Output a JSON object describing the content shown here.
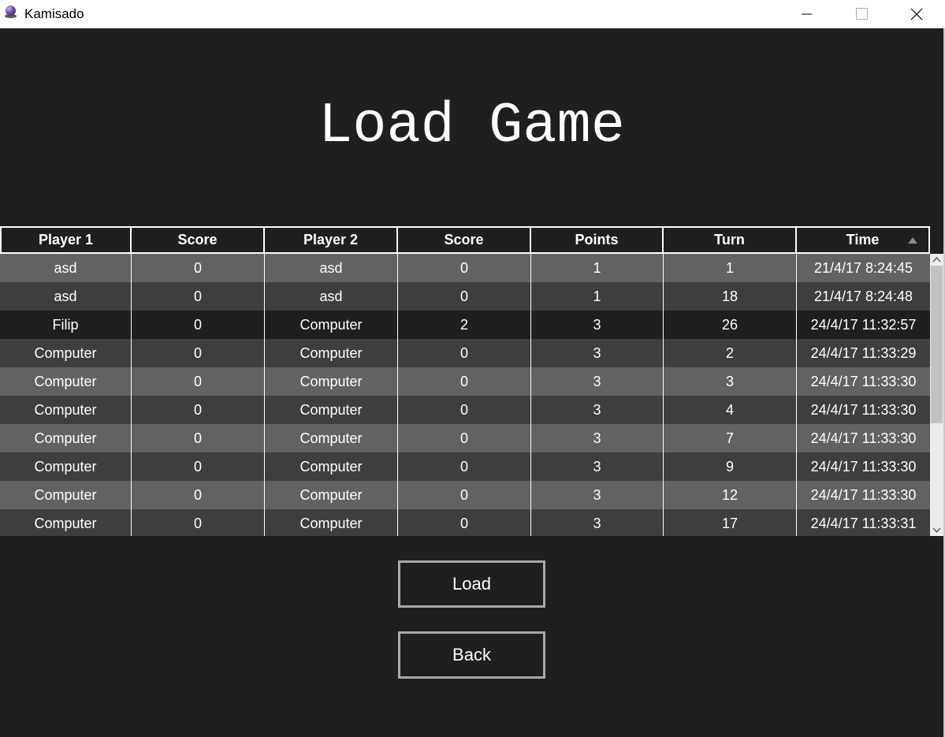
{
  "window": {
    "title": "Kamisado",
    "controls": [
      "minimize-icon",
      "maximize-icon",
      "close-icon"
    ]
  },
  "page": {
    "heading": "Load Game"
  },
  "table": {
    "columns": [
      "Player 1",
      "Score",
      "Player 2",
      "Score",
      "Points",
      "Turn",
      "Time"
    ],
    "sorted_column": "Time",
    "sort_direction": "ascending",
    "selected_row": 2,
    "rows": [
      [
        "asd",
        "0",
        "asd",
        "0",
        "1",
        "1",
        "21/4/17 8:24:45"
      ],
      [
        "asd",
        "0",
        "asd",
        "0",
        "1",
        "18",
        "21/4/17 8:24:48"
      ],
      [
        "Filip",
        "0",
        "Computer",
        "2",
        "3",
        "26",
        "24/4/17 11:32:57"
      ],
      [
        "Computer",
        "0",
        "Computer",
        "0",
        "3",
        "2",
        "24/4/17 11:33:29"
      ],
      [
        "Computer",
        "0",
        "Computer",
        "0",
        "3",
        "3",
        "24/4/17 11:33:30"
      ],
      [
        "Computer",
        "0",
        "Computer",
        "0",
        "3",
        "4",
        "24/4/17 11:33:30"
      ],
      [
        "Computer",
        "0",
        "Computer",
        "0",
        "3",
        "7",
        "24/4/17 11:33:30"
      ],
      [
        "Computer",
        "0",
        "Computer",
        "0",
        "3",
        "9",
        "24/4/17 11:33:30"
      ],
      [
        "Computer",
        "0",
        "Computer",
        "0",
        "3",
        "12",
        "24/4/17 11:33:30"
      ],
      [
        "Computer",
        "0",
        "Computer",
        "0",
        "3",
        "17",
        "24/4/17 11:33:31"
      ]
    ]
  },
  "buttons": {
    "load_label": "Load",
    "back_label": "Back"
  },
  "colors": {
    "background": "#1f1f1f",
    "row_light": "#626262",
    "row_dark": "#3e3e3e",
    "text": "#ffffff"
  }
}
